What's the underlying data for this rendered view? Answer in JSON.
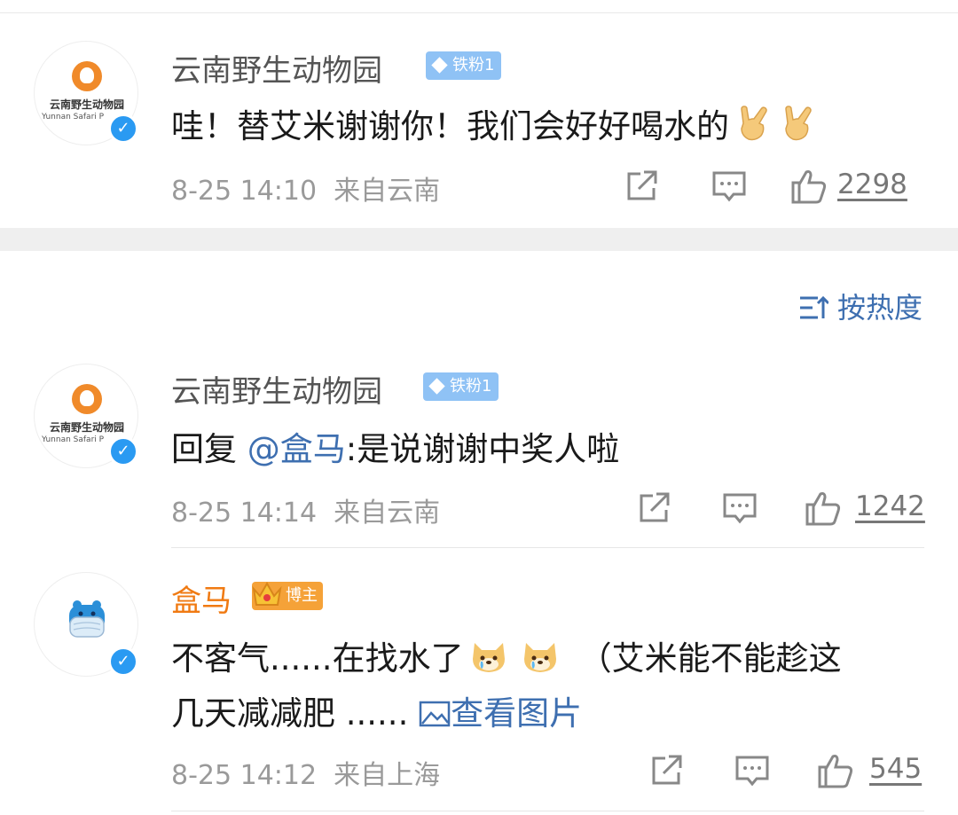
{
  "sort": {
    "label": "按热度"
  },
  "comments": [
    {
      "author": "云南野生动物园",
      "badge": "铁粉1",
      "avatar_name": "云南野生动物园",
      "avatar_en": "Yunnan Safari P",
      "text": "哇！替艾米谢谢你！我们会好好喝水的",
      "emoji": [
        "rock-hand-emoji",
        "rock-hand-emoji"
      ],
      "time": "8-25 14:10",
      "location": "来自云南",
      "likes": "2298"
    },
    {
      "author": "云南野生动物园",
      "badge": "铁粉1",
      "avatar_name": "云南野生动物园",
      "avatar_en": "Yunnan Safari P",
      "reply_prefix": "回复",
      "mention": "@盒马",
      "text": ":是说谢谢中奖人啦",
      "time": "8-25 14:14",
      "location": "来自云南",
      "likes": "1242"
    },
    {
      "author": "盒马",
      "badge": "博主",
      "text_line1_a": "不客气......在找水了",
      "text_line1_b": "（艾米能不能趁这",
      "text_line2": "几天减减肥 ......",
      "view_image": "查看图片",
      "emoji": [
        "crying-doge-emoji",
        "crying-doge-emoji"
      ],
      "time": "8-25 14:12",
      "location": "来自上海",
      "likes": "545"
    }
  ],
  "colors": {
    "accent_blue": "#3e6fb0",
    "verified": "#2a9af2",
    "blogger_orange": "#f07a12",
    "badge_blue": "#8fc2f5"
  }
}
